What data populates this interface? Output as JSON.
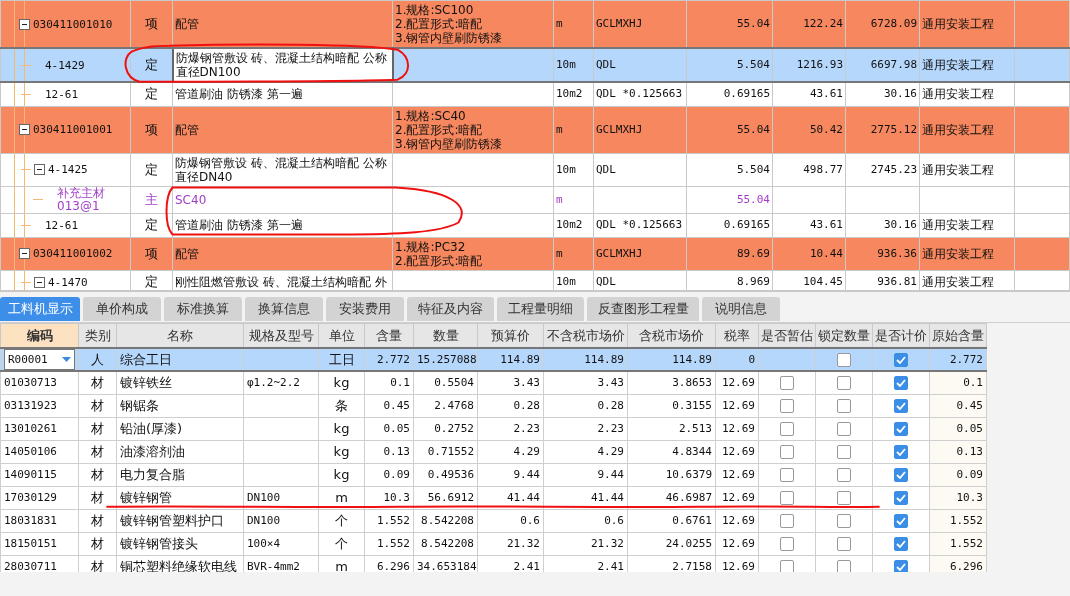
{
  "upper_rows": [
    {
      "kind": "item",
      "column_1": "030411001010",
      "column_2": "项",
      "column_3": "配管",
      "column_4": [
        "1.规格:SC100",
        "2.配置形式:暗配",
        "3.钢管内壁刷防锈漆"
      ],
      "column_5": "m",
      "column_6": "GCLMXHJ",
      "column_7": "55.04",
      "column_8": "122.24",
      "column_9": "6728.09",
      "column_10": "通用安装工程",
      "selected": false,
      "expanded": true,
      "children": [
        {
          "kind": "quota",
          "column_1": "4-1429",
          "column_2": "定",
          "column_3": "防爆钢管敷设 砖、混凝土结构暗配 公称直径DN100",
          "column_5": "10m",
          "column_6": "QDL",
          "column_7": "5.504",
          "column_8": "1216.93",
          "column_9": "6697.98",
          "column_10": "通用安装工程",
          "selected": true
        },
        {
          "kind": "quota",
          "column_1": "12-61",
          "column_2": "定",
          "column_3": "管道刷油 防锈漆 第一遍",
          "column_5": "10m2",
          "column_6": "QDL *0.125663",
          "column_7": "0.69165",
          "column_8": "43.61",
          "column_9": "30.16",
          "column_10": "通用安装工程",
          "selected": false
        }
      ]
    },
    {
      "kind": "item",
      "column_1": "030411001001",
      "column_2": "项",
      "column_3": "配管",
      "column_4": [
        "1.规格:SC40",
        "2.配置形式:暗配",
        "3.钢管内壁刷防锈漆"
      ],
      "column_5": "m",
      "column_6": "GCLMXHJ",
      "column_7": "55.04",
      "column_8": "50.42",
      "column_9": "2775.12",
      "column_10": "通用安装工程",
      "selected": false,
      "expanded": true,
      "children": [
        {
          "kind": "quota",
          "column_1": "4-1425",
          "column_2": "定",
          "column_3": "防爆钢管敷设 砖、混凝土结构暗配 公称直径DN40",
          "column_5": "10m",
          "column_6": "QDL",
          "column_7": "5.504",
          "column_8": "498.77",
          "column_9": "2745.23",
          "column_10": "通用安装工程",
          "selected": false,
          "expanded": true,
          "children": [
            {
              "kind": "material",
              "column_1": "补充主材",
              "column_1_line_2": "013@1",
              "column_2": "主",
              "column_3": "SC40",
              "column_5": "m",
              "column_7": "55.04",
              "selected": false
            }
          ]
        },
        {
          "kind": "quota",
          "column_1": "12-61",
          "column_2": "定",
          "column_3": "管道刷油 防锈漆 第一遍",
          "column_5": "10m2",
          "column_6": "QDL *0.125663",
          "column_7": "0.69165",
          "column_8": "43.61",
          "column_9": "30.16",
          "column_10": "通用安装工程",
          "selected": false
        }
      ]
    },
    {
      "kind": "item",
      "column_1": "030411001002",
      "column_2": "项",
      "column_3": "配管",
      "column_4": [
        "1.规格:PC32",
        "2.配置形式:暗配"
      ],
      "column_5": "m",
      "column_6": "GCLMXHJ",
      "column_7": "89.69",
      "column_8": "10.44",
      "column_9": "936.36",
      "column_10": "通用安装工程",
      "selected": false,
      "expanded": true,
      "children": [
        {
          "kind": "quota",
          "column_1": "4-1470",
          "column_2": "定",
          "column_3": "刚性阻燃管敷设 砖、混凝土结构暗配 外",
          "column_5": "10m",
          "column_6": "QDL",
          "column_7": "8.969",
          "column_8": "104.45",
          "column_9": "936.81",
          "column_10": "通用安装工程",
          "selected": false,
          "expanded": true
        }
      ]
    }
  ],
  "tabs": [
    {
      "label": "工料机显示",
      "selected": true
    },
    {
      "label": "单价构成",
      "selected": false
    },
    {
      "label": "标准换算",
      "selected": false
    },
    {
      "label": "换算信息",
      "selected": false
    },
    {
      "label": "安装费用",
      "selected": false
    },
    {
      "label": "特征及内容",
      "selected": false
    },
    {
      "label": "工程量明细",
      "selected": false
    },
    {
      "label": "反查图形工程量",
      "selected": false
    },
    {
      "label": "说明信息",
      "selected": false
    }
  ],
  "columns": [
    {
      "label": "编码",
      "selected": true
    },
    {
      "label": "类别",
      "selected": false
    },
    {
      "label": "名称",
      "selected": false
    },
    {
      "label": "规格及型号",
      "selected": false
    },
    {
      "label": "单位",
      "selected": false
    },
    {
      "label": "含量",
      "selected": false
    },
    {
      "label": "数量",
      "selected": false
    },
    {
      "label": "预算价",
      "selected": false
    },
    {
      "label": "不含税市场价",
      "selected": false
    },
    {
      "label": "含税市场价",
      "selected": false
    },
    {
      "label": "税率",
      "selected": false
    },
    {
      "label": "是否暂估",
      "selected": false
    },
    {
      "label": "锁定数量",
      "selected": false
    },
    {
      "label": "是否计价",
      "selected": false
    },
    {
      "label": "原始含量",
      "selected": false
    }
  ],
  "rows": [
    {
      "code": "R00001",
      "type": "人",
      "name": "综合工日",
      "unit": "工日",
      "content": "2.772",
      "quantity": "15.257088",
      "budget_price": "114.89",
      "market_price_ex_tax": "114.89",
      "market_price_inc_tax": "114.89",
      "tax_rate": "0",
      "locked": false,
      "priced": true,
      "original_content": "2.772",
      "selected": true
    },
    {
      "code": "01030713",
      "type": "材",
      "name": "镀锌铁丝",
      "spec": "φ1.2~2.2",
      "unit": "kg",
      "content": "0.1",
      "quantity": "0.5504",
      "budget_price": "3.43",
      "market_price_ex_tax": "3.43",
      "market_price_inc_tax": "3.8653",
      "tax_rate": "12.69",
      "provisional": false,
      "locked": false,
      "priced": true,
      "original_content": "0.1",
      "selected": false
    },
    {
      "code": "03131923",
      "type": "材",
      "name": "钢锯条",
      "unit": "条",
      "content": "0.45",
      "quantity": "2.4768",
      "budget_price": "0.28",
      "market_price_ex_tax": "0.28",
      "market_price_inc_tax": "0.3155",
      "tax_rate": "12.69",
      "provisional": false,
      "locked": false,
      "priced": true,
      "original_content": "0.45",
      "selected": false
    },
    {
      "code": "13010261",
      "type": "材",
      "name": "铅油(厚漆)",
      "unit": "kg",
      "content": "0.05",
      "quantity": "0.2752",
      "budget_price": "2.23",
      "market_price_ex_tax": "2.23",
      "market_price_inc_tax": "2.513",
      "tax_rate": "12.69",
      "provisional": false,
      "locked": false,
      "priced": true,
      "original_content": "0.05",
      "selected": false
    },
    {
      "code": "14050106",
      "type": "材",
      "name": "油漆溶剂油",
      "unit": "kg",
      "content": "0.13",
      "quantity": "0.71552",
      "budget_price": "4.29",
      "market_price_ex_tax": "4.29",
      "market_price_inc_tax": "4.8344",
      "tax_rate": "12.69",
      "provisional": false,
      "locked": false,
      "priced": true,
      "original_content": "0.13",
      "selected": false
    },
    {
      "code": "14090115",
      "type": "材",
      "name": "电力复合脂",
      "unit": "kg",
      "content": "0.09",
      "quantity": "0.49536",
      "budget_price": "9.44",
      "market_price_ex_tax": "9.44",
      "market_price_inc_tax": "10.6379",
      "tax_rate": "12.69",
      "provisional": false,
      "locked": false,
      "priced": true,
      "original_content": "0.09",
      "selected": false
    },
    {
      "code": "17030129",
      "type": "材",
      "name": "镀锌钢管",
      "spec": "DN100",
      "unit": "m",
      "content": "10.3",
      "quantity": "56.6912",
      "budget_price": "41.44",
      "market_price_ex_tax": "41.44",
      "market_price_inc_tax": "46.6987",
      "tax_rate": "12.69",
      "provisional": false,
      "locked": false,
      "priced": true,
      "original_content": "10.3",
      "selected": false
    },
    {
      "code": "18031831",
      "type": "材",
      "name": "镀锌钢管塑料护口",
      "spec": "DN100",
      "unit": "个",
      "content": "1.552",
      "quantity": "8.542208",
      "budget_price": "0.6",
      "market_price_ex_tax": "0.6",
      "market_price_inc_tax": "0.6761",
      "tax_rate": "12.69",
      "provisional": false,
      "locked": false,
      "priced": true,
      "original_content": "1.552",
      "selected": false
    },
    {
      "code": "18150151",
      "type": "材",
      "name": "镀锌钢管接头",
      "spec": "100×4",
      "unit": "个",
      "content": "1.552",
      "quantity": "8.542208",
      "budget_price": "21.32",
      "market_price_ex_tax": "21.32",
      "market_price_inc_tax": "24.0255",
      "tax_rate": "12.69",
      "provisional": false,
      "locked": false,
      "priced": true,
      "original_content": "1.552",
      "selected": false
    },
    {
      "code": "28030711",
      "type": "材",
      "name": "铜芯塑料绝缘软电线",
      "spec": "BVR-4mm2",
      "unit": "m",
      "content": "6.296",
      "quantity": "34.653184",
      "budget_price": "2.41",
      "market_price_ex_tax": "2.41",
      "market_price_inc_tax": "2.7158",
      "tax_rate": "12.69",
      "provisional": false,
      "locked": false,
      "priced": true,
      "original_content": "6.296",
      "selected": false
    }
  ],
  "annotations": [
    {
      "kind": "ellipse"
    },
    {
      "kind": "ellipse"
    },
    {
      "kind": "underline"
    }
  ]
}
